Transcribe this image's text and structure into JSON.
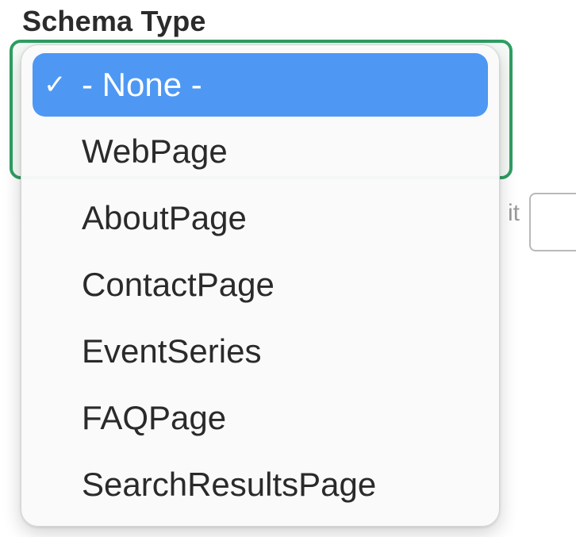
{
  "field": {
    "label": "Schema Type"
  },
  "background": {
    "partial_text": "it"
  },
  "dropdown": {
    "selected_value": "- None -",
    "options": [
      {
        "label": "- None -",
        "selected": true,
        "check": "✓"
      },
      {
        "label": "WebPage",
        "selected": false,
        "check": ""
      },
      {
        "label": "AboutPage",
        "selected": false,
        "check": ""
      },
      {
        "label": "ContactPage",
        "selected": false,
        "check": ""
      },
      {
        "label": "EventSeries",
        "selected": false,
        "check": ""
      },
      {
        "label": "FAQPage",
        "selected": false,
        "check": ""
      },
      {
        "label": "SearchResultsPage",
        "selected": false,
        "check": ""
      }
    ]
  },
  "colors": {
    "focus_ring": "#2f9e62",
    "highlight": "#4e98f4"
  }
}
